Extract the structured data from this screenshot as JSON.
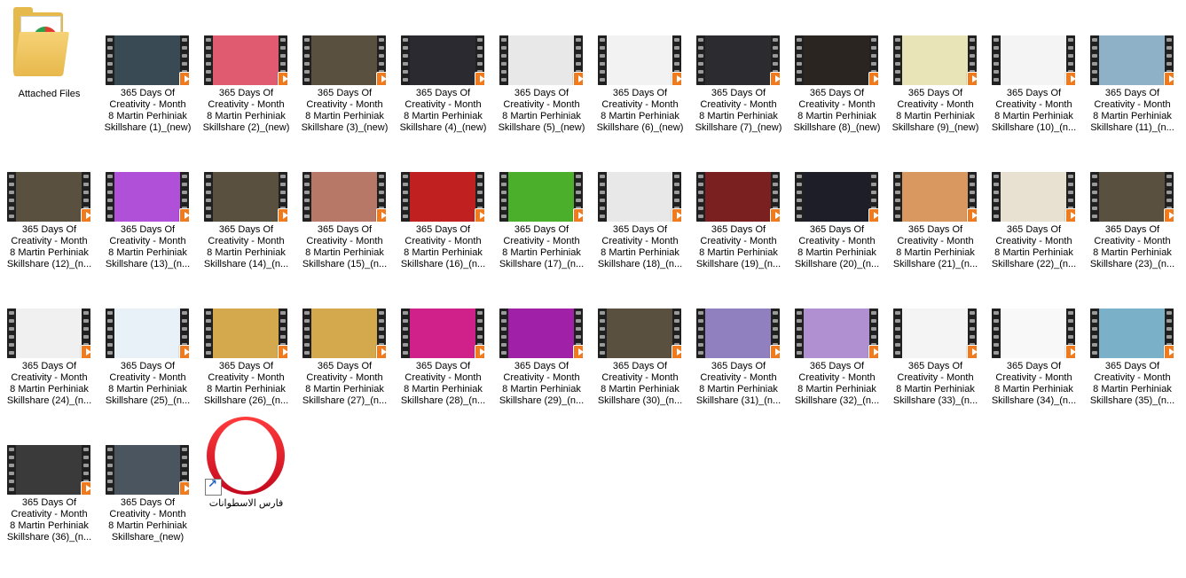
{
  "folder": {
    "label": "Attached Files",
    "icon": "folder-chrome-icon"
  },
  "videos": [
    {
      "label": "365 Days Of\nCreativity - Month\n8  Martin Perhiniak\nSkillshare (1)_(new)",
      "frame": "#3a4a55"
    },
    {
      "label": "365 Days Of\nCreativity - Month\n8  Martin Perhiniak\nSkillshare (2)_(new)",
      "frame": "#e05a70"
    },
    {
      "label": "365 Days Of\nCreativity - Month\n8  Martin Perhiniak\nSkillshare (3)_(new)",
      "frame": "#5a5040"
    },
    {
      "label": "365 Days Of\nCreativity - Month\n8  Martin Perhiniak\nSkillshare (4)_(new)",
      "frame": "#2a2a30"
    },
    {
      "label": "365 Days Of\nCreativity - Month\n8  Martin Perhiniak\nSkillshare (5)_(new)",
      "frame": "#e8e8e8"
    },
    {
      "label": "365 Days Of\nCreativity - Month\n8  Martin Perhiniak\nSkillshare (6)_(new)",
      "frame": "#f2f2f2"
    },
    {
      "label": "365 Days Of\nCreativity - Month\n8  Martin Perhiniak\nSkillshare (7)_(new)",
      "frame": "#2c2c30"
    },
    {
      "label": "365 Days Of\nCreativity - Month\n8  Martin Perhiniak\nSkillshare (8)_(new)",
      "frame": "#2a2520"
    },
    {
      "label": "365 Days Of\nCreativity - Month\n8  Martin Perhiniak\nSkillshare (9)_(new)",
      "frame": "#e9e4b8"
    },
    {
      "label": "365 Days Of\nCreativity - Month\n8  Martin Perhiniak\nSkillshare (10)_(n...",
      "frame": "#f4f4f4"
    },
    {
      "label": "365 Days Of\nCreativity - Month\n8  Martin Perhiniak\nSkillshare (11)_(n...",
      "frame": "#8fb1c8"
    },
    {
      "label": "365 Days Of\nCreativity - Month\n8  Martin Perhiniak\nSkillshare (12)_(n...",
      "frame": "#5a5040"
    },
    {
      "label": "365 Days Of\nCreativity - Month\n8  Martin Perhiniak\nSkillshare (13)_(n...",
      "frame": "#b04fd8"
    },
    {
      "label": "365 Days Of\nCreativity - Month\n8  Martin Perhiniak\nSkillshare (14)_(n...",
      "frame": "#5a5040"
    },
    {
      "label": "365 Days Of\nCreativity - Month\n8  Martin Perhiniak\nSkillshare (15)_(n...",
      "frame": "#b87868"
    },
    {
      "label": "365 Days Of\nCreativity - Month\n8  Martin Perhiniak\nSkillshare (16)_(n...",
      "frame": "#c02020"
    },
    {
      "label": "365 Days Of\nCreativity - Month\n8  Martin Perhiniak\nSkillshare (17)_(n...",
      "frame": "#4caf2c"
    },
    {
      "label": "365 Days Of\nCreativity - Month\n8  Martin Perhiniak\nSkillshare (18)_(n...",
      "frame": "#e8e8e8"
    },
    {
      "label": "365 Days Of\nCreativity - Month\n8  Martin Perhiniak\nSkillshare (19)_(n...",
      "frame": "#7a2020"
    },
    {
      "label": "365 Days Of\nCreativity - Month\n8  Martin Perhiniak\nSkillshare (20)_(n...",
      "frame": "#1e1e28"
    },
    {
      "label": "365 Days Of\nCreativity - Month\n8  Martin Perhiniak\nSkillshare (21)_(n...",
      "frame": "#d99860"
    },
    {
      "label": "365 Days Of\nCreativity - Month\n8  Martin Perhiniak\nSkillshare (22)_(n...",
      "frame": "#e8e0d0"
    },
    {
      "label": "365 Days Of\nCreativity - Month\n8  Martin Perhiniak\nSkillshare (23)_(n...",
      "frame": "#5a5040"
    },
    {
      "label": "365 Days Of\nCreativity - Month\n8  Martin Perhiniak\nSkillshare (24)_(n...",
      "frame": "#f0f0f0"
    },
    {
      "label": "365 Days Of\nCreativity - Month\n8  Martin Perhiniak\nSkillshare (25)_(n...",
      "frame": "#e8f0f8"
    },
    {
      "label": "365 Days Of\nCreativity - Month\n8  Martin Perhiniak\nSkillshare (26)_(n...",
      "frame": "#d4a84c"
    },
    {
      "label": "365 Days Of\nCreativity - Month\n8  Martin Perhiniak\nSkillshare (27)_(n...",
      "frame": "#d4a84c"
    },
    {
      "label": "365 Days Of\nCreativity - Month\n8  Martin Perhiniak\nSkillshare (28)_(n...",
      "frame": "#d0208a"
    },
    {
      "label": "365 Days Of\nCreativity - Month\n8  Martin Perhiniak\nSkillshare (29)_(n...",
      "frame": "#a020a8"
    },
    {
      "label": "365 Days Of\nCreativity - Month\n8  Martin Perhiniak\nSkillshare (30)_(n...",
      "frame": "#5a5040"
    },
    {
      "label": "365 Days Of\nCreativity - Month\n8  Martin Perhiniak\nSkillshare (31)_(n...",
      "frame": "#9080c0"
    },
    {
      "label": "365 Days Of\nCreativity - Month\n8  Martin Perhiniak\nSkillshare (32)_(n...",
      "frame": "#b090d0"
    },
    {
      "label": "365 Days Of\nCreativity - Month\n8  Martin Perhiniak\nSkillshare (33)_(n...",
      "frame": "#f4f4f4"
    },
    {
      "label": "365 Days Of\nCreativity - Month\n8  Martin Perhiniak\nSkillshare (34)_(n...",
      "frame": "#f8f8f8"
    },
    {
      "label": "365 Days Of\nCreativity - Month\n8  Martin Perhiniak\nSkillshare (35)_(n...",
      "frame": "#7ab0c8"
    },
    {
      "label": "365 Days Of\nCreativity - Month\n8  Martin Perhiniak\nSkillshare (36)_(n...",
      "frame": "#3a3a3a"
    },
    {
      "label": "365 Days Of\nCreativity - Month\n8  Martin Perhiniak\nSkillshare_(new)",
      "frame": "#4a5560"
    }
  ],
  "shortcut": {
    "label": "فارس الاسطوانات",
    "icon": "opera-icon"
  }
}
